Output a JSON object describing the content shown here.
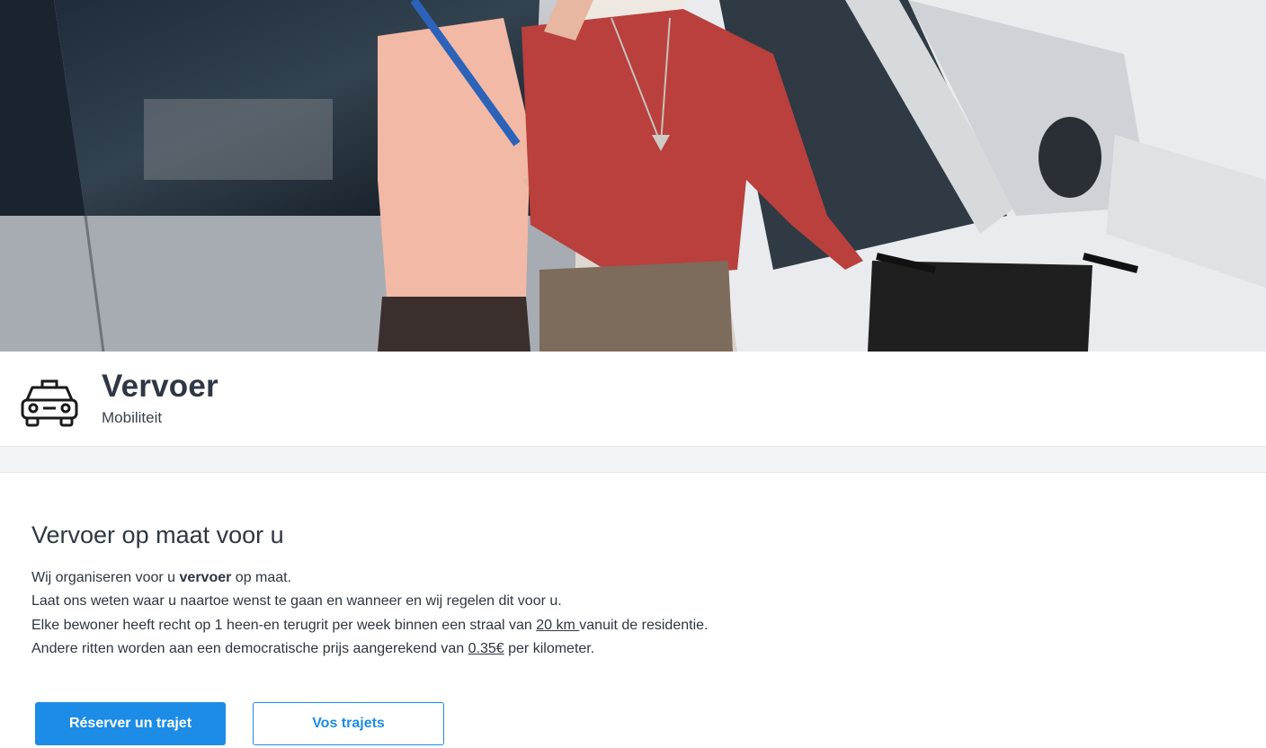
{
  "header": {
    "title": "Vervoer",
    "subtitle": "Mobiliteit",
    "icon": "taxi-icon"
  },
  "content": {
    "heading": "Vervoer op maat voor u",
    "line1_pre": "Wij organiseren voor u ",
    "line1_bold": "vervoer",
    "line1_post": " op maat.",
    "line2": "Laat ons weten waar u naartoe wenst te gaan en wanneer en wij regelen dit voor u.",
    "line3_pre": "Elke bewoner heeft recht op 1 heen-en terugrit per week binnen een straal van ",
    "line3_link": "20 km ",
    "line3_post": "vanuit de residentie.",
    "line4_pre": "Andere ritten worden aan een democratische prijs aangerekend van ",
    "line4_link": "0.35€",
    "line4_post": " per kilometer."
  },
  "actions": {
    "reserve_label": "Réserver un trajet",
    "trips_label": "Vos trajets"
  },
  "colors": {
    "accent": "#1c8ce6",
    "text": "#2f3542",
    "band": "#f3f4f6"
  }
}
